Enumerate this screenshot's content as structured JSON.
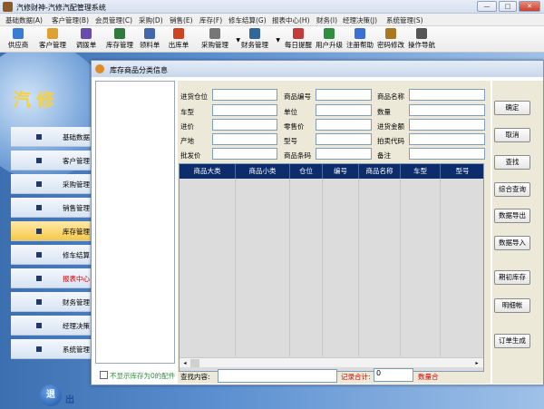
{
  "window": {
    "title": "汽修财神-汽修汽配管理系统",
    "controls": [
      "—",
      "□",
      "✕"
    ]
  },
  "menu": [
    "基础数据(A)",
    "客户管理(B)",
    "会员管理(C)",
    "采购(D)",
    "销售(E)",
    "库存(F)",
    "修车结算(G)",
    "报表中心(H)",
    "财务(I)",
    "经理决策(J)",
    "系统管理(S)"
  ],
  "toolbar": [
    {
      "label": "供应商",
      "icon": "supplier-icon",
      "color": "#3a7bd5"
    },
    {
      "label": "客户管理",
      "icon": "customer-icon",
      "color": "#e0a030"
    },
    {
      "label": "调拨单",
      "icon": "transfer-icon",
      "color": "#6a4caf"
    },
    {
      "label": "库存管理",
      "icon": "inventory-icon",
      "color": "#2f7a3f"
    },
    {
      "label": "领料单",
      "icon": "requisition-icon",
      "color": "#4466aa"
    },
    {
      "label": "出库单",
      "icon": "outbound-icon",
      "color": "#cc4422"
    },
    {
      "label": "采购管理",
      "icon": "purchase-icon",
      "color": "#777777"
    },
    {
      "label": "财务管理",
      "icon": "finance-icon",
      "color": "#336699"
    },
    {
      "label": "每日提醒",
      "icon": "reminder-icon",
      "color": "#c33b3b"
    },
    {
      "label": "用户升级",
      "icon": "upgrade-icon",
      "color": "#2f8f3f"
    },
    {
      "label": "注册帮助",
      "icon": "help-icon",
      "color": "#3a6fd5"
    },
    {
      "label": "密码修改",
      "icon": "password-icon",
      "color": "#aa7722"
    },
    {
      "label": "操作导航",
      "icon": "navigation-icon",
      "color": "#555555"
    }
  ],
  "brand": "汽修",
  "sidebar": [
    {
      "label": "基础数据",
      "style": "normal"
    },
    {
      "label": "客户管理",
      "style": "normal"
    },
    {
      "label": "采购管理",
      "style": "normal"
    },
    {
      "label": "销售管理",
      "style": "normal"
    },
    {
      "label": "库存管理",
      "style": "active"
    },
    {
      "label": "修车结算",
      "style": "normal"
    },
    {
      "label": "报表中心",
      "style": "red"
    },
    {
      "label": "财务管理",
      "style": "normal"
    },
    {
      "label": "经理决策",
      "style": "normal"
    },
    {
      "label": "系统管理",
      "style": "normal"
    }
  ],
  "exit": {
    "icon_text": "退",
    "label": "出"
  },
  "dialog": {
    "title": "库存商品分类信息",
    "fields": {
      "col1": [
        "进货仓位",
        "车型",
        "进价",
        "产地",
        "批发价"
      ],
      "col2": [
        "商品编号",
        "单位",
        "零售价",
        "型号",
        "商品条码"
      ],
      "col3": [
        "商品名称",
        "数量",
        "进货金额",
        "拍卖代码",
        "备注"
      ]
    },
    "grid_headers": [
      "商品大类",
      "商品小类",
      "仓位",
      "编号",
      "商品名称",
      "车型",
      "型号"
    ],
    "buttons": [
      "确定",
      "取消",
      "查找",
      "综合查询",
      "数据导出",
      "数据导入",
      "期初库存",
      "明细帐",
      "订单生成"
    ],
    "bottom": {
      "checkbox": "不显示库存为0的配件",
      "search_label": "查找内容:",
      "record_label": "记录合计:",
      "record_value": "0",
      "quantity_label": "数量合"
    }
  },
  "colors": {
    "grid_header": "#0c2c6c",
    "red_text": "#d00000",
    "checkbox_text": "#2f8f3f",
    "brand": "#f2d04a"
  }
}
